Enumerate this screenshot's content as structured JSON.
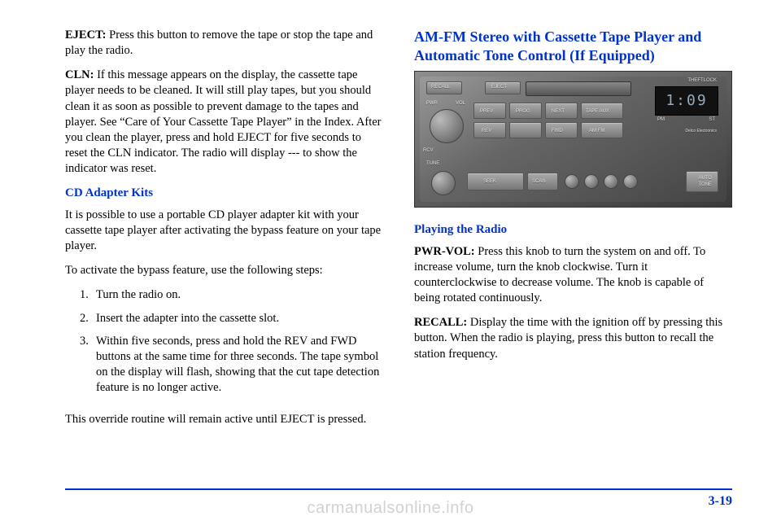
{
  "left": {
    "p1_bold": "EJECT:",
    "p1_text": " Press this button to remove the tape or stop the tape and play the radio.",
    "p2_bold": "CLN:",
    "p2_text": " If this message appears on the display, the cassette tape player needs to be cleaned. It will still play tapes, but you should clean it as soon as possible to prevent damage to the tapes and player. See “Care of Your Cassette Tape Player” in the Index. After you clean the player, press and hold EJECT for five seconds to reset the CLN indicator. The radio will display --- to show the indicator was reset.",
    "h_cd": "CD Adapter Kits",
    "p3": "It is possible to use a portable CD player adapter kit with your cassette tape player after activating the bypass feature on your tape player.",
    "p4": "To activate the bypass feature, use the following steps:",
    "steps": [
      "Turn the radio on.",
      "Insert the adapter into the cassette slot.",
      "Within five seconds, press and hold the REV and FWD buttons at the same time for three seconds. The tape symbol on the display will flash, showing that the cut tape detection feature is no longer active."
    ],
    "p5": "This override routine will remain active until EJECT is pressed."
  },
  "right": {
    "h_main": "AM-FM Stereo with Cassette Tape Player and Automatic Tone Control (If Equipped)",
    "radio": {
      "display": "1:09",
      "labels": {
        "recall": "RECALL",
        "eject": "EJECT",
        "theftlock": "THEFTLOCK",
        "pwr": "PWR",
        "vol": "VOL",
        "tune": "TUNE",
        "seek": "SEEK",
        "scan": "SCAN",
        "prev": "PREV",
        "prog": "PROG",
        "next": "NEXT",
        "rev": "REV",
        "fwd": "FWD",
        "amfm": "AM FM",
        "tape": "TAPE AUX",
        "pm": "PM",
        "st": "ST",
        "brand": "Delco Electronics",
        "auto": "AUTO\nTONE",
        "rcv": "RCV"
      }
    },
    "h_play": "Playing the Radio",
    "p1_bold": "PWR-VOL:",
    "p1_text": " Press this knob to turn the system on and off. To increase volume, turn the knob clockwise. Turn it counterclockwise to decrease volume. The knob is capable of being rotated continuously.",
    "p2_bold": "RECALL:",
    "p2_text": " Display the time with the ignition off by pressing this button. When the radio is playing, press this button to recall the station frequency."
  },
  "page_number": "3-19",
  "watermark": "carmanualsonline.info"
}
